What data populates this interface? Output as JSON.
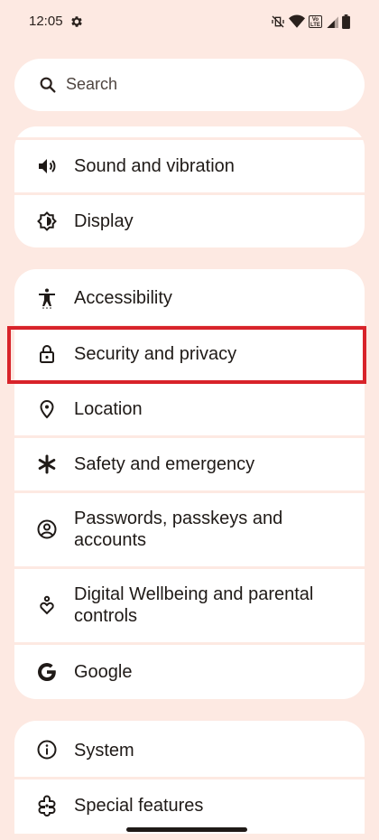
{
  "status_bar": {
    "time": "12:05",
    "volte_label": "Vo LTE"
  },
  "search": {
    "placeholder": "Search"
  },
  "groups": [
    {
      "items": [
        {
          "label": "Sound and vibration",
          "icon": "volume-icon"
        },
        {
          "label": "Display",
          "icon": "brightness-icon"
        }
      ]
    },
    {
      "items": [
        {
          "label": "Accessibility",
          "icon": "accessibility-icon"
        },
        {
          "label": "Security and privacy",
          "icon": "lock-icon",
          "highlighted": true
        },
        {
          "label": "Location",
          "icon": "location-pin-icon"
        },
        {
          "label": "Safety and emergency",
          "icon": "asterisk-icon"
        },
        {
          "label": "Passwords, passkeys and accounts",
          "icon": "account-circle-icon"
        },
        {
          "label": "Digital Wellbeing and parental controls",
          "icon": "wellbeing-icon"
        },
        {
          "label": "Google",
          "icon": "google-g-icon"
        }
      ]
    },
    {
      "items": [
        {
          "label": "System",
          "icon": "info-icon"
        },
        {
          "label": "Special features",
          "icon": "special-features-icon"
        }
      ]
    }
  ],
  "colors": {
    "background": "#fde9e2",
    "card": "#ffffff",
    "highlight": "#d8232a",
    "text": "#1f1a17"
  }
}
